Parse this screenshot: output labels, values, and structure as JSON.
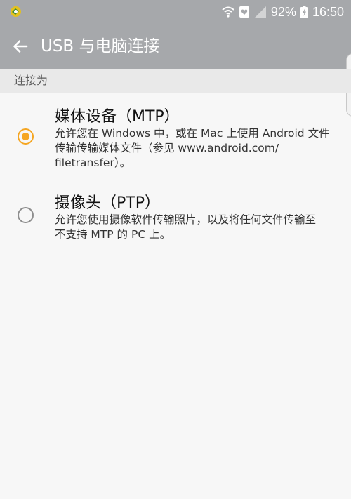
{
  "status_bar": {
    "battery_percent": "92%",
    "time": "16:50",
    "icons": [
      "app-notification-icon",
      "wifi-icon",
      "heart-rate-icon",
      "signal-icon",
      "battery-charging-icon"
    ]
  },
  "toolbar": {
    "back_icon": "arrow-left-icon",
    "title": "USB 与电脑连接"
  },
  "section": {
    "label": "连接为"
  },
  "options": [
    {
      "title": "媒体设备（MTP）",
      "description_lines": [
        "允许您在 Windows 中，或在 Mac 上使用 Android 文件",
        "传输传输媒体文件（参见 www.android.com/",
        "filetransfer）。"
      ],
      "selected": true
    },
    {
      "title": "摄像头（PTP）",
      "description_lines": [
        "允许您使用摄像软件传输照片，以及将任何文件传输至",
        "不支持 MTP 的 PC 上。"
      ],
      "selected": false
    }
  ],
  "colors": {
    "accent": "#f5a623",
    "toolbar": "#a6a8ab",
    "background": "#f7f7f7"
  }
}
